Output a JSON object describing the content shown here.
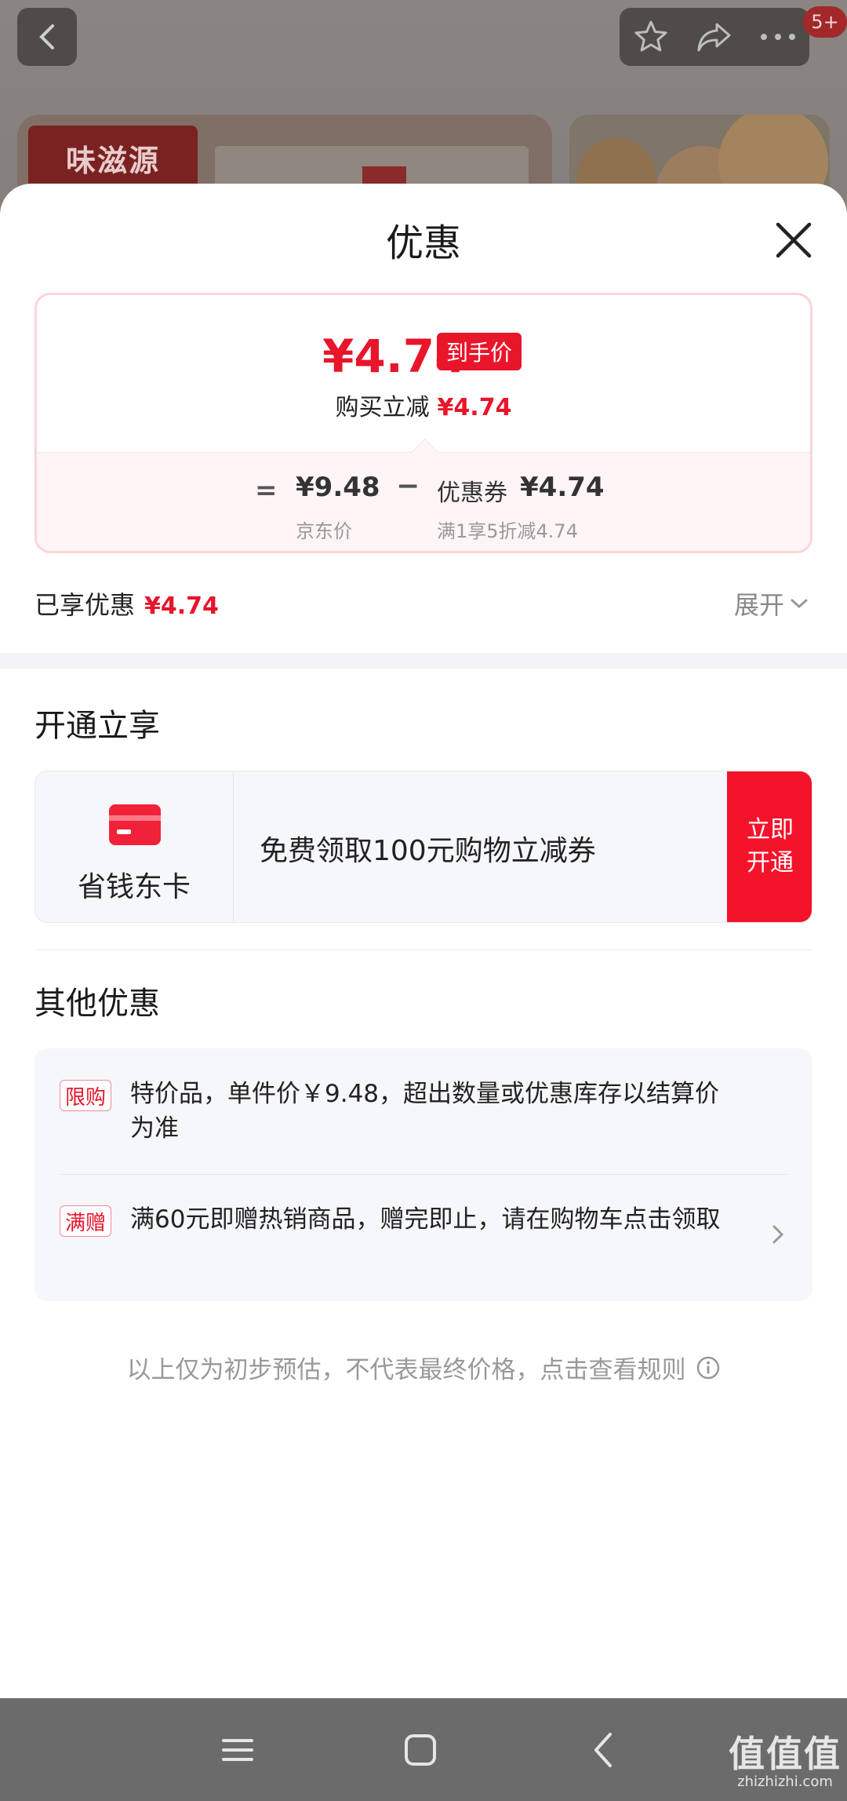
{
  "background": {
    "brand_logo": "味滋源",
    "badge": "5+"
  },
  "sheet": {
    "title": "优惠",
    "price_summary": {
      "final_price": "¥4.74",
      "final_tag": "到手价",
      "reduce_label": "购买立减",
      "reduce_amount": "¥4.74",
      "equals": "=",
      "jd_price": "¥9.48",
      "jd_label": "京东价",
      "minus": "−",
      "coupon_label": "优惠券",
      "coupon_amount": "¥4.74",
      "coupon_rule": "满1享5折减4.74"
    },
    "enjoyed": {
      "label": "已享优惠",
      "amount": "¥4.74",
      "expand_label": "展开"
    },
    "membership": {
      "section_title": "开通立享",
      "card_name": "省钱东卡",
      "offer_text": "免费领取100元购物立减券",
      "button_label": "立即开通"
    },
    "other": {
      "section_title": "其他优惠",
      "promos": [
        {
          "tag": "限购",
          "text": "特价品，单件价￥9.48，超出数量或优惠库存以结算价为准"
        },
        {
          "tag": "满赠",
          "text": "满60元即赠热销商品，赠完即止，请在购物车点击领取"
        }
      ]
    },
    "footnote": "以上仅为初步预估，不代表最终价格，点击查看规则"
  },
  "colors": {
    "accent": "#e8152b",
    "button": "#f5122b",
    "navbar": "#6b6b6b"
  },
  "icons": [
    "back-icon",
    "star-icon",
    "share-icon",
    "more-icon",
    "close-icon",
    "card-icon",
    "chevron-down-icon",
    "chevron-right-icon",
    "info-icon",
    "menu-icon",
    "home-icon",
    "nav-back-icon"
  ]
}
